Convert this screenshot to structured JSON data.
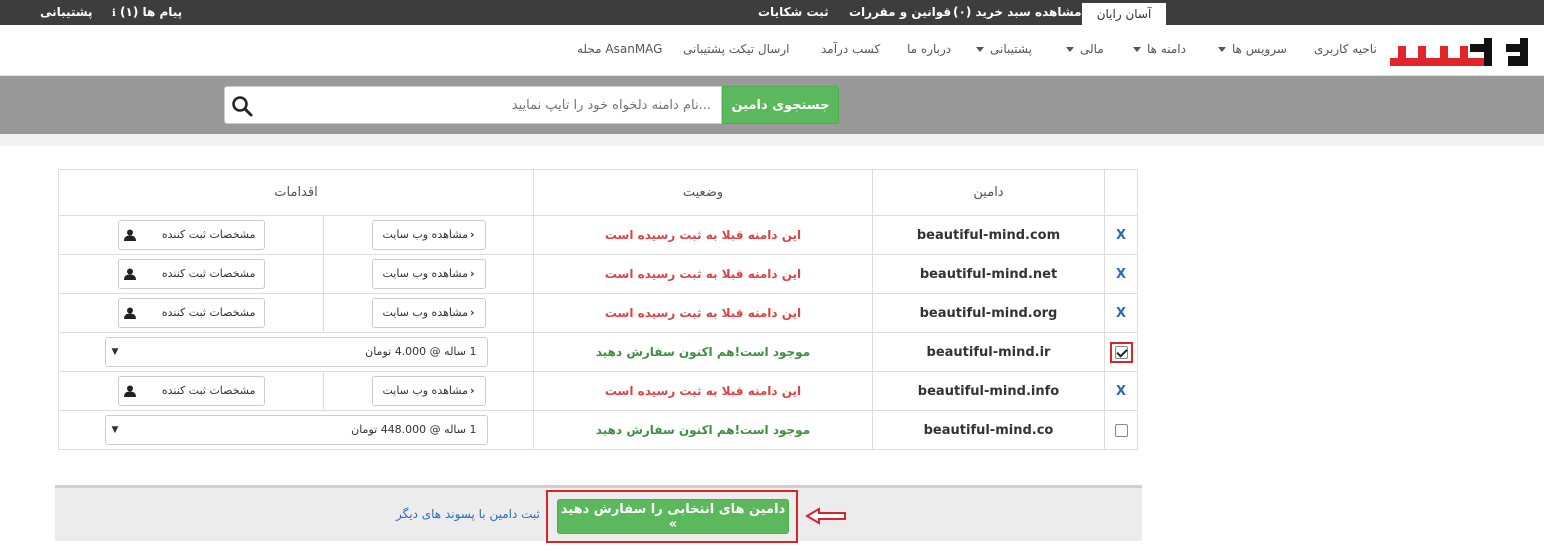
{
  "topbar": {
    "support": "پشتیبانی",
    "messages": "پیام ها (۱)",
    "complaints": "ثبت شکایات",
    "rules": "قوانین و مقررات",
    "cart": "مشاهده سبد خرید (۰)",
    "active_tab": "آسان رایان"
  },
  "nav": {
    "items": [
      {
        "label": "ناحیه کاربری"
      },
      {
        "label": "سرویس ها"
      },
      {
        "label": "دامنه ها"
      },
      {
        "label": "مالی"
      },
      {
        "label": "پشتیبانی"
      },
      {
        "label": "درباره ما"
      },
      {
        "label": "کسب درآمد"
      },
      {
        "label": "ارسال تیکت پشتیبانی"
      },
      {
        "label": "مجله AsanMAG"
      }
    ],
    "logo_text": "آسان رایان"
  },
  "search": {
    "placeholder": "...نام دامنه دلخواه خود را تایپ نمایید",
    "button": "جستجوی دامین"
  },
  "table": {
    "headers": {
      "domain": "دامین",
      "status": "وضعیت",
      "actions": "اقدامات"
    },
    "unavailable_mark": "X",
    "view_site": "مشاهده وب سایت",
    "registrant": "مشخصات ثبت کننده",
    "rows": [
      {
        "domain": "beautiful-mind.com",
        "status": "این دامنه قبلا به ثبت رسیده است"
      },
      {
        "domain": "beautiful-mind.net",
        "status": "این دامنه قبلا به ثبت رسیده است"
      },
      {
        "domain": "beautiful-mind.org",
        "status": "این دامنه قبلا به ثبت رسیده است"
      },
      {
        "domain": "beautiful-mind.ir",
        "status": "موجود است!هم اکنون سفارش دهید",
        "price": "1 ساله @ 4.000 تومان"
      },
      {
        "domain": "beautiful-mind.info",
        "status": "این دامنه قبلا به ثبت رسیده است"
      },
      {
        "domain": "beautiful-mind.co",
        "status": "موجود است!هم اکنون سفارش دهید",
        "price": "1 ساله @ 448.000 تومان"
      }
    ]
  },
  "bottom": {
    "order_button": "دامین های انتخابی را سفارش دهید »",
    "other_suffix_link": "ثبت دامین با پسوند های دیگر"
  },
  "colors": {
    "green": "#5cb85c",
    "red_status": "#e04343",
    "green_status": "#3f8f3f",
    "highlight": "#d9242a",
    "topbar": "#3d3d3d"
  }
}
